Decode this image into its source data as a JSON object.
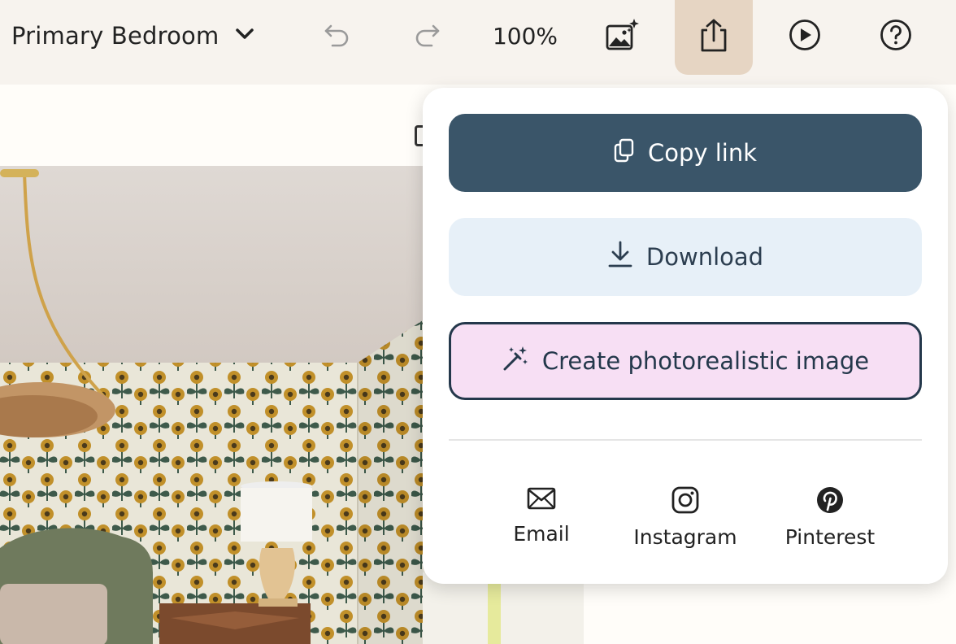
{
  "toolbar": {
    "room_name": "Primary Bedroom",
    "zoom": "100%",
    "icons": {
      "dropdown": "chevron-down-icon",
      "undo": "undo-icon",
      "redo": "redo-icon",
      "ai_image": "image-sparkle-icon",
      "share": "share-icon",
      "play": "play-icon",
      "help": "help-icon"
    }
  },
  "share_menu": {
    "copy_link": {
      "label": "Copy link",
      "icon": "copy-icon"
    },
    "download": {
      "label": "Download",
      "icon": "download-icon"
    },
    "create": {
      "label": "Create photorealistic image",
      "icon": "magic-wand-icon"
    },
    "social": [
      {
        "label": "Email",
        "icon": "email-icon"
      },
      {
        "label": "Instagram",
        "icon": "instagram-icon"
      },
      {
        "label": "Pinterest",
        "icon": "pinterest-icon"
      }
    ]
  },
  "colors": {
    "toolbar_bg": "#f7f3ee",
    "share_active_bg": "#e6d5c3",
    "copy_button_bg": "#3a5569",
    "download_button_bg": "#e7f0f8",
    "create_button_bg": "#f7dff4",
    "wallpaper_bg": "#e9e6d8",
    "flower": "#c1902a"
  }
}
